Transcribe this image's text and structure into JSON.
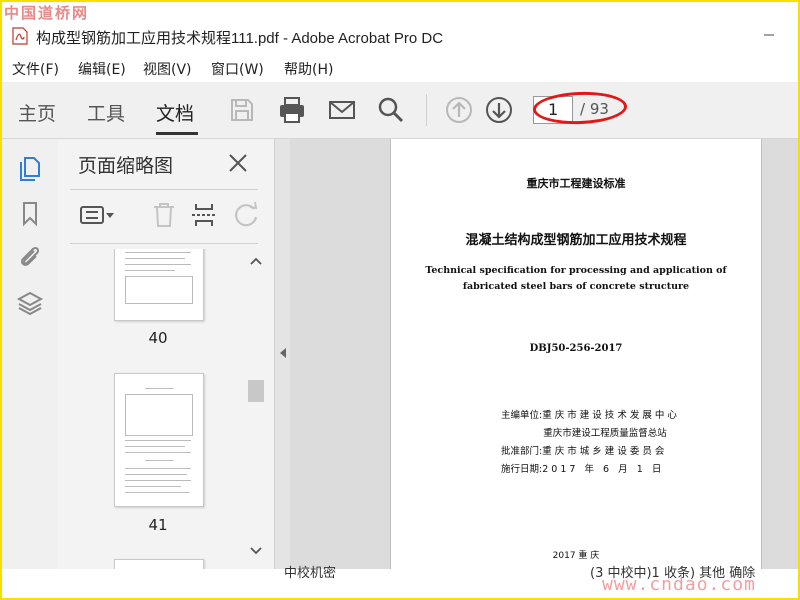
{
  "watermark_top": "中国道桥网",
  "window": {
    "title": "构成型钢筋加工应用技术规程111.pdf - Adobe Acrobat Pro DC"
  },
  "menu": [
    "文件(F)",
    "编辑(E)",
    "视图(V)",
    "窗口(W)",
    "帮助(H)"
  ],
  "toolbar": {
    "tabs": [
      "主页",
      "工具",
      "文档"
    ],
    "active_tab": "文档",
    "page_current": "1",
    "page_total": "/ 93"
  },
  "thumbnails_panel": {
    "title": "页面缩略图",
    "pages": [
      "40",
      "41"
    ]
  },
  "document_page": {
    "org": "重庆市工程建设标准",
    "title_cn": "混凝土结构成型钢筋加工应用技术规程",
    "title_en_line1": "Technical specification for processing and application of",
    "title_en_line2": "fabricated steel bars of concrete structure",
    "code": "DBJ50-256-2017",
    "info_lines": [
      "主编单位:重 庆 市 建 设 技 术 发 展 中 心",
      "              重庆市建设工程质量监督总站",
      "批准部门:重 庆 市 城 乡 建 设 委 员 会",
      "施行日期:2 0 1 7   年   6   月   1   日"
    ],
    "footer": "2017   重   庆"
  },
  "bottom_fragments": [
    "中校机密",
    "(3 中校中)1 收条) 其他 确除"
  ],
  "watermark_bottom": "www.cndao.com",
  "colors": {
    "accent_blue": "#2f7ed8",
    "annotation_red": "#e01818",
    "frame_yellow": "#f7e000"
  }
}
